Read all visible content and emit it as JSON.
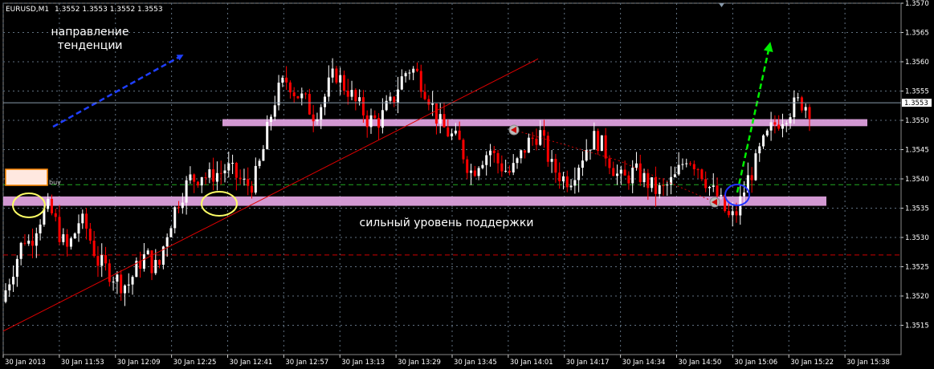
{
  "header": {
    "symbol": "EURUSD,M1",
    "ohlc": "1.3552 1.3553 1.3552 1.3553"
  },
  "annotations": {
    "trend_line1": "направление",
    "trend_line2": "тенденции",
    "support": "сильный уровень поддержки",
    "buy": "buy"
  },
  "colors": {
    "background": "#000000",
    "bull": "#ffffff",
    "bear": "#ff0000",
    "zone": "#dda0dd",
    "grid": "#607080",
    "trend_arrow": "#1f3fff",
    "up_arrow": "#00ee00",
    "circle_yellow": "#ffff66",
    "circle_blue": "#2233ff"
  },
  "chart_data": {
    "type": "candlestick",
    "ylim": [
      1.351,
      1.357
    ],
    "current_price": "1.3553",
    "y_ticks": [
      "1.3570",
      "1.3565",
      "1.3560",
      "1.3555",
      "1.3550",
      "1.3545",
      "1.3540",
      "1.3535",
      "1.3530",
      "1.3525",
      "1.3520",
      "1.3515"
    ],
    "x_ticks": [
      "30 Jan 2013",
      "30 Jan 11:53",
      "30 Jan 12:09",
      "30 Jan 12:25",
      "30 Jan 12:41",
      "30 Jan 12:57",
      "30 Jan 13:13",
      "30 Jan 13:29",
      "30 Jan 13:45",
      "30 Jan 14:01",
      "30 Jan 14:17",
      "30 Jan 14:34",
      "30 Jan 14:50",
      "30 Jan 15:06",
      "30 Jan 15:22",
      "30 Jan 15:38"
    ],
    "support_zones": [
      {
        "low": 1.3549,
        "high": 1.35502
      },
      {
        "low": 1.35354,
        "high": 1.3537
      }
    ],
    "horizontal_lines": [
      {
        "price": 1.3539,
        "style": "dashed",
        "color": "#22aa22"
      },
      {
        "price": 1.3527,
        "style": "dashed",
        "color": "#cc0000"
      }
    ],
    "trend_line": {
      "from_index": 0,
      "from_price": 1.3514,
      "to_index": 210,
      "to_price": 1.35605
    },
    "path_close": [
      1.3521,
      1.3524,
      1.3527,
      1.353,
      1.3529,
      1.3532,
      1.3534,
      1.3535,
      1.3533,
      1.353,
      1.3528,
      1.353,
      1.3533,
      1.3532,
      1.3529,
      1.3526,
      1.3525,
      1.3524,
      1.3523,
      1.3522,
      1.3522,
      1.3524,
      1.3526,
      1.3527,
      1.3525,
      1.3525,
      1.353,
      1.3533,
      1.3536,
      1.3538,
      1.354,
      1.354,
      1.3541,
      1.354,
      1.3541,
      1.3541,
      1.3542,
      1.3541,
      1.354,
      1.3539,
      1.3539,
      1.3541,
      1.3545,
      1.355,
      1.3554,
      1.3556,
      1.3557,
      1.3555,
      1.3554,
      1.3553,
      1.3551,
      1.3552,
      1.3554,
      1.3557,
      1.3558,
      1.3556,
      1.3555,
      1.3553,
      1.3552,
      1.355,
      1.355,
      1.355,
      1.3552,
      1.3553,
      1.3556,
      1.3558,
      1.3559,
      1.3558,
      1.3556,
      1.3554,
      1.3551,
      1.3549,
      1.3548,
      1.3547,
      1.3546,
      1.3543,
      1.3541,
      1.3543,
      1.3544,
      1.3545,
      1.3543,
      1.3542,
      1.3541,
      1.3542,
      1.3544,
      1.3546,
      1.3547,
      1.3548,
      1.3545,
      1.3542,
      1.3541,
      1.354,
      1.354,
      1.3542,
      1.3544,
      1.3546,
      1.3547,
      1.3546,
      1.3544,
      1.3542,
      1.354,
      1.354,
      1.3541,
      1.3541,
      1.354,
      1.3539,
      1.3538,
      1.3538,
      1.3539,
      1.354,
      1.3542,
      1.3544,
      1.3543,
      1.3542,
      1.354,
      1.3538,
      1.3537,
      1.3535,
      1.3533,
      1.3534,
      1.3537,
      1.354,
      1.3542,
      1.3545,
      1.3547,
      1.3549,
      1.355,
      1.3551,
      1.3552,
      1.3553,
      1.3553,
      1.3552
    ],
    "points": [
      {
        "o": 1.3519,
        "h": 1.3523,
        "l": 1.3518,
        "c": 1.3521
      },
      {
        "o": 1.3521,
        "h": 1.3526,
        "l": 1.352,
        "c": 1.3524
      },
      {
        "o": 1.3524,
        "h": 1.3528,
        "l": 1.3522,
        "c": 1.3526
      },
      {
        "o": 1.3526,
        "h": 1.353,
        "l": 1.3525,
        "c": 1.3529
      },
      {
        "o": 1.3529,
        "h": 1.3531,
        "l": 1.3527,
        "c": 1.353
      },
      {
        "o": 1.353,
        "h": 1.3534,
        "l": 1.3529,
        "c": 1.3533
      },
      {
        "o": 1.3533,
        "h": 1.3536,
        "l": 1.3531,
        "c": 1.3535
      },
      {
        "o": 1.3535,
        "h": 1.3537,
        "l": 1.3533,
        "c": 1.3536
      },
      {
        "o": 1.3536,
        "h": 1.3536,
        "l": 1.3532,
        "c": 1.3533
      },
      {
        "o": 1.3533,
        "h": 1.3534,
        "l": 1.3529,
        "c": 1.353
      }
    ]
  }
}
